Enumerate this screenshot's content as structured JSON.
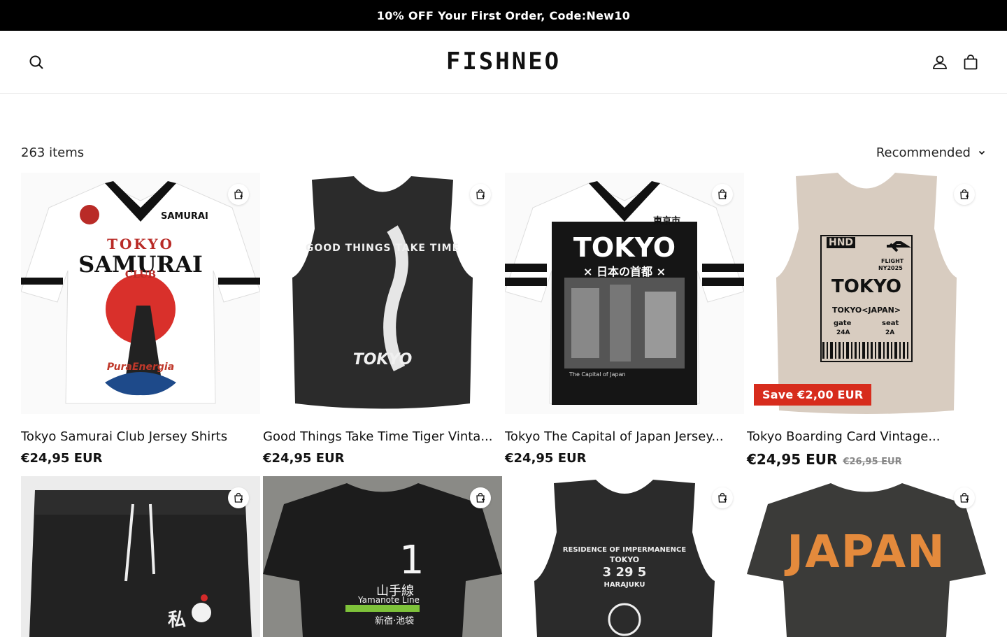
{
  "announcement": "10% OFF Your First Order, Code:New10",
  "header": {
    "logo": "FISHNEO"
  },
  "toolbar": {
    "count": "263 items",
    "sort": "Recommended"
  },
  "products": [
    {
      "title": "Tokyo Samurai Club Jersey Shirts",
      "price": "€24,95 EUR",
      "art": {
        "line1": "TOKYO",
        "line2": "SAMURAI",
        "line3": "CLUB",
        "line4": "PuraEnergia",
        "corner": "SAMURAI"
      }
    },
    {
      "title": "Good Things Take Time Tiger Vinta...",
      "price": "€24,95 EUR",
      "art": {
        "arc": "GOOD THINGS TAKE TIME",
        "bottom": "TOKYO"
      }
    },
    {
      "title": "Tokyo The Capital of Japan Jersey...",
      "price": "€24,95 EUR",
      "art": {
        "line1": "TOKYO",
        "line2": "× 日本の首都 ×",
        "corner": "東京市",
        "caption": "The Capital of Japan"
      }
    },
    {
      "title": "Tokyo Boarding Card Vintage...",
      "price": "€24,95 EUR",
      "compare": "€26,95 EUR",
      "badge": "Save €2,00 EUR",
      "art": {
        "code": "HND",
        "flight": "FLIGHT",
        "flightno": "NY2025",
        "city": "TOKYO",
        "dest": "TOKYO<JAPAN>",
        "gate_label": "gate",
        "gate": "24A",
        "seat_label": "seat",
        "seat": "2A"
      }
    },
    {
      "art": {
        "kanji": "私"
      }
    },
    {
      "art": {
        "number": "1",
        "line": "山手線",
        "romaji": "Yamanote Line",
        "stations": "新宿·池袋"
      }
    },
    {
      "art": {
        "arc": "RESIDENCE OF IMPERMANENCE",
        "city": "TOKYO",
        "numbers": "3 29 5",
        "district": "HARAJUKU"
      }
    },
    {
      "art": {
        "word": "JAPAN"
      }
    }
  ]
}
